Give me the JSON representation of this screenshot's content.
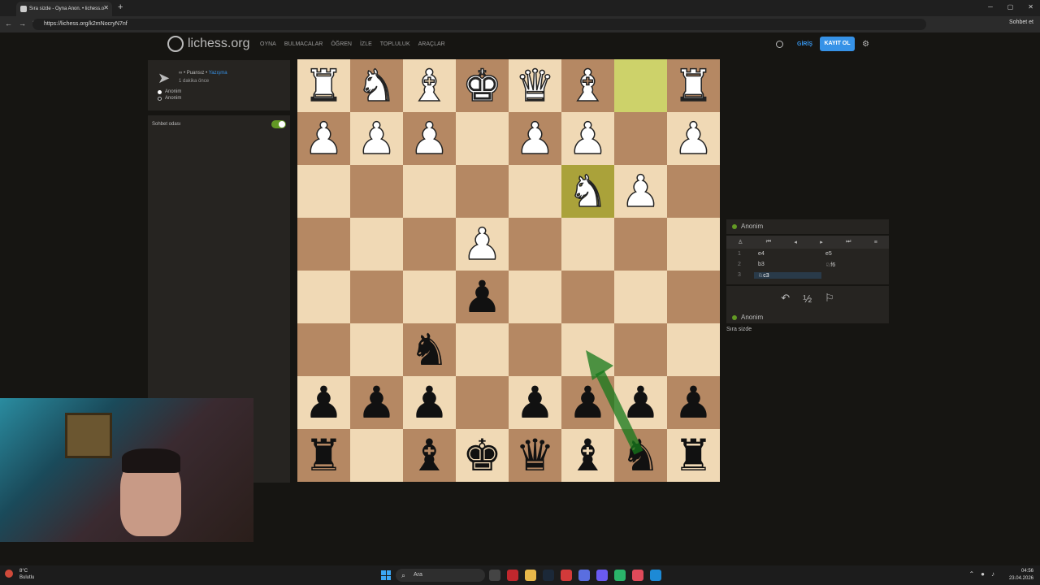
{
  "browser": {
    "tab_title": "Sıra sizde - Oyna Anon. • lichess.o",
    "tab_close": "✕",
    "new_tab": "+",
    "url": "https://lichess.org/k2mNocryN7nf",
    "sohbet_et": "Sohbet et"
  },
  "header": {
    "brand": "lichess.org",
    "nav": [
      "OYNA",
      "BULMACALAR",
      "ÖĞREN",
      "İZLE",
      "TOPLULUK",
      "ARAÇLAR"
    ],
    "login": "GİRİŞ",
    "signup": "KAYIT OL"
  },
  "game_meta": {
    "icon": "∞",
    "mode": "• Puansız •",
    "variant_link": "Yazışma",
    "time_ago": "1 dakika önce",
    "players": [
      {
        "name": "Anonim",
        "color": "#ffffff"
      },
      {
        "name": "Anonim",
        "color": "#111111"
      }
    ]
  },
  "chat": {
    "title": "Sohbet odası"
  },
  "board": {
    "rows": [
      [
        "wR",
        "wN",
        "wB",
        "wK",
        "wQ",
        "wB",
        "",
        "wR"
      ],
      [
        "wP",
        "wP",
        "wP",
        "",
        "wP",
        "wP",
        "",
        "wP"
      ],
      [
        "",
        "",
        "",
        "",
        "",
        "wN",
        "wP",
        ""
      ],
      [
        "",
        "",
        "",
        "wP",
        "",
        "",
        "",
        ""
      ],
      [
        "",
        "",
        "",
        "bP",
        "",
        "",
        "",
        ""
      ],
      [
        "",
        "",
        "bN",
        "",
        "",
        "",
        "",
        ""
      ],
      [
        "bP",
        "bP",
        "bP",
        "",
        "bP",
        "bP",
        "bP",
        "bP"
      ],
      [
        "bR",
        "",
        "bB",
        "bK",
        "bQ",
        "bB",
        "bN",
        "bR"
      ]
    ],
    "highlight": [
      [
        0,
        6
      ],
      [
        2,
        5
      ]
    ],
    "arrow_color": "#15781b"
  },
  "moves_panel": {
    "opponent": "Anonim",
    "me": "Anonim",
    "controls": [
      "♙",
      "⏮",
      "◂",
      "▸",
      "⏭",
      "≡"
    ],
    "moves": [
      {
        "num": "1",
        "white": "e4",
        "black": "e5"
      },
      {
        "num": "2",
        "white": "b3",
        "black": "♘f6"
      },
      {
        "num": "3",
        "white": "♘c3",
        "black": ""
      }
    ],
    "actions": [
      "↶",
      "½",
      "⚐"
    ],
    "turn_text": "Sıra sizde"
  },
  "taskbar": {
    "weather_temp": "8°C",
    "weather_desc": "Bulutlu",
    "search": "Ara",
    "time": "04:56",
    "date": "23.04.2026"
  }
}
